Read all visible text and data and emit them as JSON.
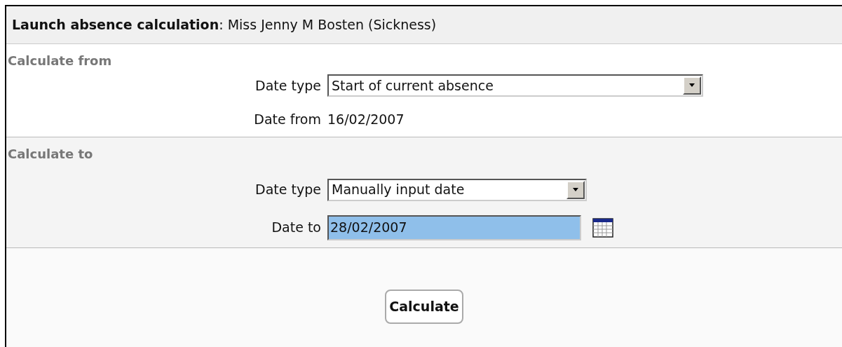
{
  "header": {
    "title": "Launch absence calculation",
    "subtitle": ": Miss Jenny M Bosten (Sickness)"
  },
  "sections": [
    {
      "heading": "Calculate from",
      "fields": [
        {
          "kind": "select",
          "label": "Date type",
          "value": "Start of current absence"
        },
        {
          "kind": "text",
          "label": "Date from",
          "value": "16/02/2007"
        }
      ]
    },
    {
      "heading": "Calculate to",
      "fields": [
        {
          "kind": "select",
          "label": "Date type",
          "value": "Manually input date"
        },
        {
          "kind": "date",
          "label": "Date to",
          "value": "28/02/2007",
          "selected": true
        }
      ]
    }
  ],
  "button": "Calculate"
}
